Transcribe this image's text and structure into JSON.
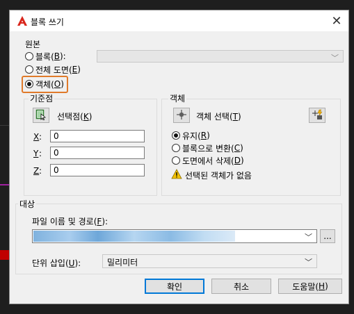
{
  "dialog": {
    "title": "블록 쓰기",
    "close_label": "✕"
  },
  "source": {
    "label": "원본",
    "options": [
      {
        "label_prefix": "블록(",
        "accel": "B",
        "label_suffix": "):",
        "checked": false
      },
      {
        "label_prefix": "전체 도면(",
        "accel": "E",
        "label_suffix": ")",
        "checked": false
      },
      {
        "label_prefix": "객체(",
        "accel": "O",
        "label_suffix": ")",
        "checked": true
      }
    ],
    "block_combo_arrow": "﹀"
  },
  "base_point": {
    "label": "기준점",
    "pick_prefix": "선택점(",
    "pick_accel": "K",
    "pick_suffix": ")",
    "x_label": "X",
    "x_value": "0",
    "y_label": "Y",
    "y_value": "0",
    "z_label": "Z",
    "z_value": "0"
  },
  "objects": {
    "label": "객체",
    "select_prefix": "객체 선택(",
    "select_accel": "T",
    "select_suffix": ")",
    "options": [
      {
        "label_prefix": "유지(",
        "accel": "R",
        "label_suffix": ")",
        "checked": true
      },
      {
        "label_prefix": "블록으로 변환(",
        "accel": "C",
        "label_suffix": ")",
        "checked": false
      },
      {
        "label_prefix": "도면에서 삭제(",
        "accel": "D",
        "label_suffix": ")",
        "checked": false
      }
    ],
    "warning": "선택된 객체가 없음"
  },
  "destination": {
    "label": "대상",
    "file_label_prefix": "파일 이름 및 경로(",
    "file_accel": "F",
    "file_label_suffix": "):",
    "browse_label": "...",
    "units_label_prefix": "단위 삽입(",
    "units_accel": "U",
    "units_label_suffix": "):",
    "units_value": "밀리미터",
    "combo_arrow": "﹀"
  },
  "buttons": {
    "ok": "확인",
    "cancel": "취소",
    "help_prefix": "도움말(",
    "help_accel": "H",
    "help_suffix": ")"
  },
  "colors": {
    "accent": "#0078d7",
    "highlight": "#e07a2a",
    "title_icon": "#d9261c",
    "warning": "#f2c200"
  }
}
